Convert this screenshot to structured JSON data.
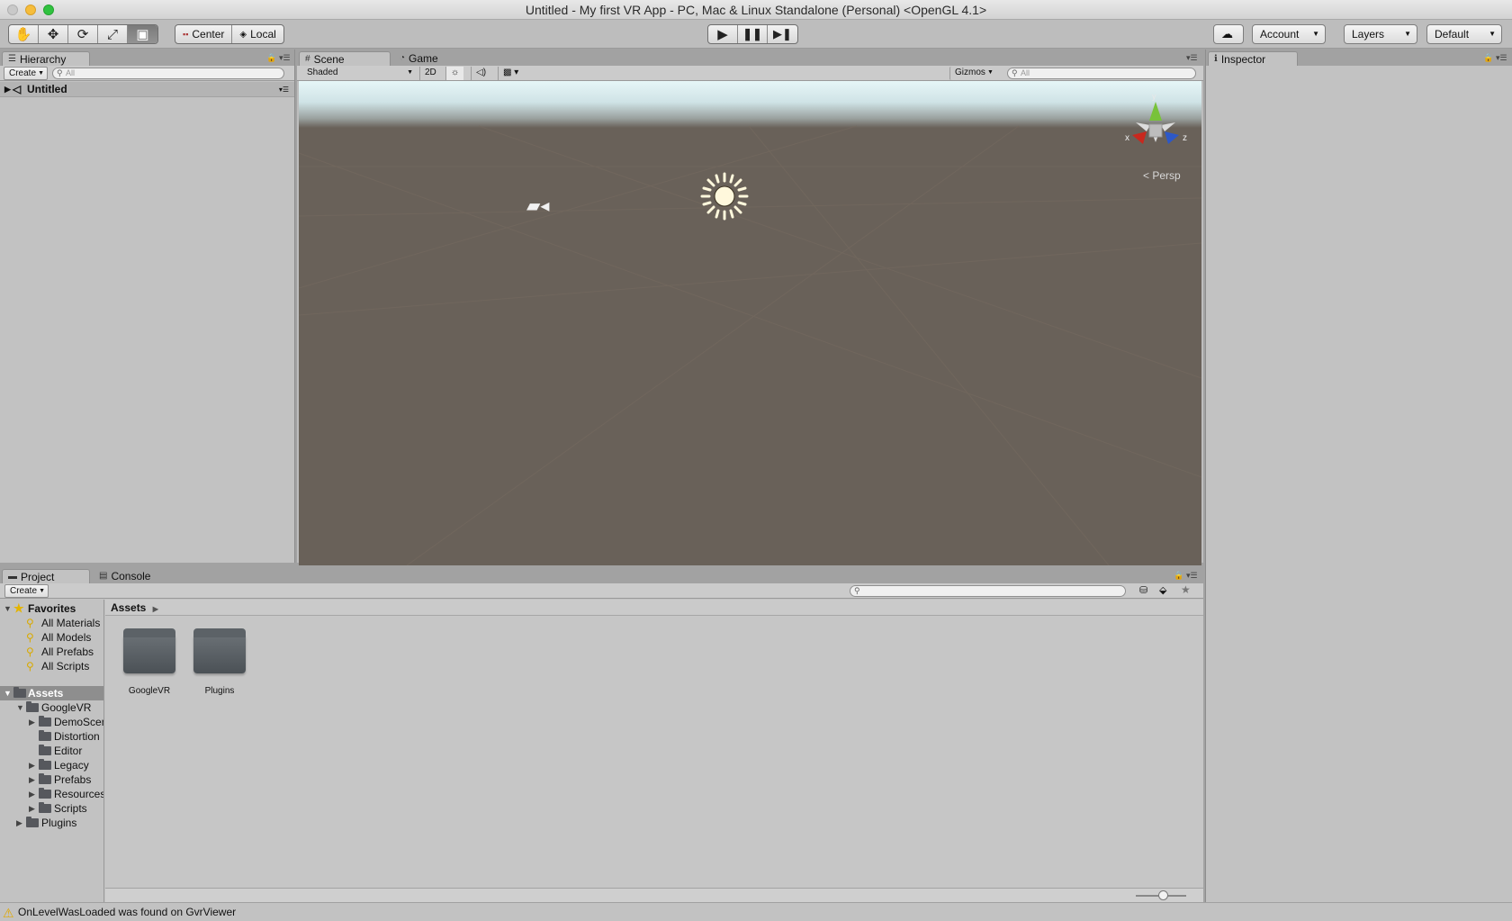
{
  "window": {
    "title": "Untitled - My first VR App - PC, Mac & Linux Standalone (Personal) <OpenGL 4.1>"
  },
  "toolbar": {
    "transform_tools": [
      "hand-tool",
      "move-tool",
      "rotate-tool",
      "scale-tool",
      "rect-tool"
    ],
    "pivot_mode": "Center",
    "pivot_rotation": "Local",
    "play_controls": [
      "play",
      "pause",
      "step"
    ],
    "account_label": "Account",
    "layers_label": "Layers",
    "layout_label": "Default"
  },
  "hierarchy": {
    "tab_label": "Hierarchy",
    "create_label": "Create",
    "search_placeholder": "All",
    "scene_name": "Untitled"
  },
  "scene": {
    "tabs": [
      {
        "label": "Scene",
        "active": true
      },
      {
        "label": "Game",
        "active": false
      }
    ],
    "shading_mode": "Shaded",
    "mode_2d_label": "2D",
    "gizmos_label": "Gizmos",
    "search_placeholder": "All",
    "orientation_label": "Persp",
    "axes": {
      "x": "x",
      "y": "y",
      "z": "z"
    },
    "sky_color": "#e6f6f7",
    "ground_color": "#696159"
  },
  "inspector": {
    "tab_label": "Inspector"
  },
  "project": {
    "tabs": [
      {
        "label": "Project",
        "active": true
      },
      {
        "label": "Console",
        "active": false
      }
    ],
    "create_label": "Create",
    "favorites": {
      "label": "Favorites",
      "items": [
        "All Materials",
        "All Models",
        "All Prefabs",
        "All Scripts"
      ]
    },
    "tree": {
      "root": "Assets",
      "googlevr": "GoogleVR",
      "children": [
        "DemoScenes",
        "Distortion",
        "Editor",
        "Legacy",
        "Prefabs",
        "Resources",
        "Scripts"
      ],
      "plugins": "Plugins"
    },
    "breadcrumb": "Assets",
    "folders": [
      "GoogleVR",
      "Plugins"
    ]
  },
  "status": {
    "message": "OnLevelWasLoaded was found on GvrViewer"
  }
}
